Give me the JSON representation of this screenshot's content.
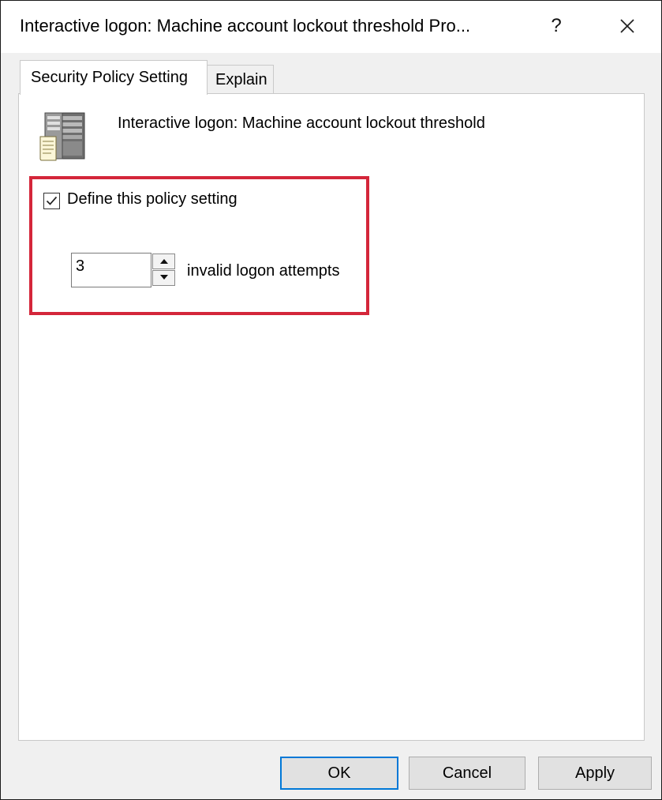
{
  "window": {
    "title": "Interactive logon: Machine account lockout threshold Pro...",
    "help_glyph": "?",
    "close_glyph": "✕"
  },
  "tabs": [
    {
      "label": "Security Policy Setting",
      "selected": true
    },
    {
      "label": "Explain",
      "selected": false
    }
  ],
  "policy": {
    "icon": "server-policy-icon",
    "title": "Interactive logon: Machine account lockout threshold"
  },
  "define_setting": {
    "checked": true,
    "label": "Define this policy setting"
  },
  "threshold": {
    "value": "3",
    "unit_label": "invalid logon attempts"
  },
  "buttons": {
    "ok": "OK",
    "cancel": "Cancel",
    "apply": "Apply"
  },
  "colors": {
    "highlight": "#d4263a",
    "default_button_border": "#0078d7"
  }
}
